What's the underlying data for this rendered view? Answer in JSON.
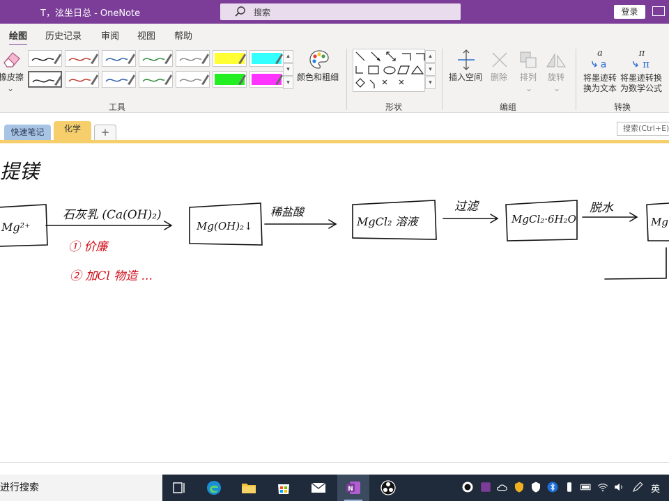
{
  "window": {
    "title": "T，泫坐日总  -  OneNote",
    "search_placeholder": "搜索",
    "signin_label": "登录"
  },
  "ribbon_tabs": [
    {
      "label": "绘图",
      "active": true
    },
    {
      "label": "历史记录"
    },
    {
      "label": "审阅"
    },
    {
      "label": "视图"
    },
    {
      "label": "帮助"
    }
  ],
  "ribbon": {
    "eraser_label": "橡皮擦",
    "eraser_chevron": "⌄",
    "color_thickness_label": "颜色和粗细",
    "tools_group": "工具",
    "shapes_group": "形状",
    "insert_space_label": "插入空间",
    "delete_label": "删除",
    "arrange_label": "排列",
    "rotate_label": "旋转",
    "edit_group": "编组",
    "ink_to_text_label": "将墨迹转换为文本",
    "ink_to_text_line1": "将墨迹转",
    "ink_to_text_line2": "换为文本",
    "ink_to_math_line1": "将墨迹转换",
    "ink_to_math_line2": "为数学公式",
    "convert_group": "转换",
    "pens_row1": [
      {
        "color": "#222222",
        "kind": "pen"
      },
      {
        "color": "#c0392b",
        "kind": "pen"
      },
      {
        "color": "#2e5fa8",
        "kind": "pen"
      },
      {
        "color": "#2e8b3a",
        "kind": "pen"
      },
      {
        "color": "#888888",
        "kind": "pen"
      },
      {
        "color": "#ffff33",
        "kind": "highlighter"
      },
      {
        "color": "#33ffff",
        "kind": "highlighter"
      }
    ],
    "pens_row2": [
      {
        "color": "#222222",
        "kind": "pen",
        "selected": true
      },
      {
        "color": "#c0392b",
        "kind": "pen"
      },
      {
        "color": "#2e5fa8",
        "kind": "pen"
      },
      {
        "color": "#2e8b3a",
        "kind": "pen"
      },
      {
        "color": "#888888",
        "kind": "pen"
      },
      {
        "color": "#22ee22",
        "kind": "highlighter"
      },
      {
        "color": "#ff33ff",
        "kind": "highlighter"
      }
    ]
  },
  "sections": {
    "quick_notes": "快速笔记",
    "chemistry": "化学",
    "add": "+"
  },
  "page_search_placeholder": "搜索(Ctrl+E)",
  "handwriting": {
    "title": "提镁",
    "start_box": "Mg²⁺",
    "arrow1_label": "石灰乳 (Ca(OH)₂)",
    "note1": "① 价廉",
    "note2": "② 加Cl 物造 ...",
    "box2": "Mg(OH)₂↓",
    "arrow2_label": "稀盐酸",
    "box3": "MgCl₂ 溶液",
    "arrow3_label": "过滤",
    "box4": "MgCl₂·6H₂O",
    "arrow4_label": "脱水",
    "box5": "Mg"
  },
  "taskbar": {
    "search_label": "进行搜索",
    "ime": "英",
    "colors": {
      "accent": "#7b3d98",
      "section_chem": "#f6cf6c",
      "section_quick": "#a8c4e4",
      "taskbar": "#1f2b3a"
    }
  }
}
